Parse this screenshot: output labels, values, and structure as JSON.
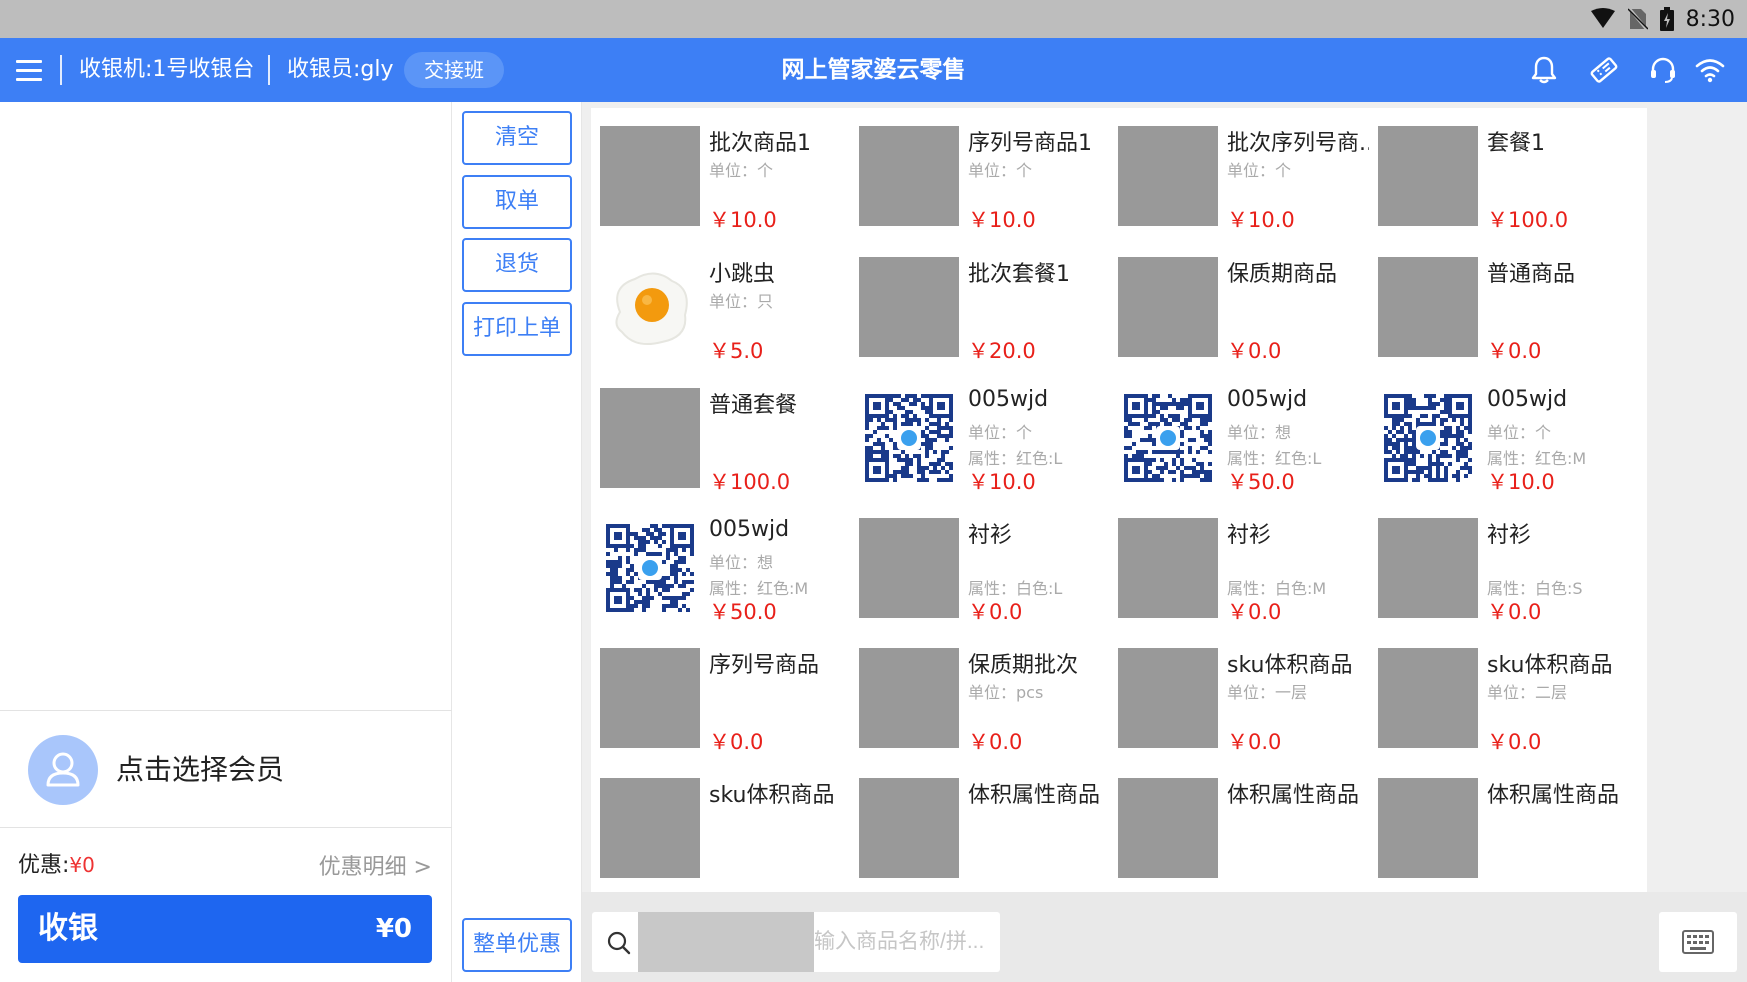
{
  "status_bar": {
    "time": "8:30"
  },
  "header": {
    "register": "收银机:1号收银台",
    "cashier": "收银员:gly",
    "shift_button": "交接班",
    "title": "网上管家婆云零售"
  },
  "actions": {
    "clear": "清空",
    "retrieve": "取单",
    "return": "退货",
    "print_last": "打印上单",
    "order_discount": "整单优惠"
  },
  "member": {
    "prompt": "点击选择会员"
  },
  "discount": {
    "label": "优惠:",
    "value": "¥0",
    "detail": "优惠明细 >"
  },
  "checkout": {
    "label": "收银",
    "amount": "¥0"
  },
  "search": {
    "placeholder": "输入商品名称/拼..."
  },
  "products": [
    {
      "name": "批次商品1",
      "unit": "单位：个",
      "attr": "",
      "price": "￥10.0",
      "image": "gray"
    },
    {
      "name": "序列号商品1",
      "unit": "单位：个",
      "attr": "",
      "price": "￥10.0",
      "image": "gray"
    },
    {
      "name": "批次序列号商...",
      "unit": "单位：个",
      "attr": "",
      "price": "￥10.0",
      "image": "gray"
    },
    {
      "name": "套餐1",
      "unit": "",
      "attr": "",
      "price": "￥100.0",
      "image": "gray"
    },
    {
      "name": "小跳虫",
      "unit": "单位：只",
      "attr": "",
      "price": "￥5.0",
      "image": "egg"
    },
    {
      "name": "批次套餐1",
      "unit": "",
      "attr": "",
      "price": "￥20.0",
      "image": "gray"
    },
    {
      "name": "保质期商品",
      "unit": "",
      "attr": "",
      "price": "￥0.0",
      "image": "gray"
    },
    {
      "name": "普通商品",
      "unit": "",
      "attr": "",
      "price": "￥0.0",
      "image": "gray"
    },
    {
      "name": "普通套餐",
      "unit": "",
      "attr": "",
      "price": "￥100.0",
      "image": "gray"
    },
    {
      "name": "005wjd",
      "unit": "单位：个",
      "attr": "属性：红色:L",
      "price": "￥10.0",
      "image": "qr"
    },
    {
      "name": "005wjd",
      "unit": "单位：想",
      "attr": "属性：红色:L",
      "price": "￥50.0",
      "image": "qr"
    },
    {
      "name": "005wjd",
      "unit": "单位：个",
      "attr": "属性：红色:M",
      "price": "￥10.0",
      "image": "qr"
    },
    {
      "name": "005wjd",
      "unit": "单位：想",
      "attr": "属性：红色:M",
      "price": "￥50.0",
      "image": "qr"
    },
    {
      "name": "衬衫",
      "unit": "",
      "attr": "属性：白色:L",
      "price": "￥0.0",
      "image": "gray"
    },
    {
      "name": "衬衫",
      "unit": "",
      "attr": "属性：白色:M",
      "price": "￥0.0",
      "image": "gray"
    },
    {
      "name": "衬衫",
      "unit": "",
      "attr": "属性：白色:S",
      "price": "￥0.0",
      "image": "gray"
    },
    {
      "name": "序列号商品",
      "unit": "",
      "attr": "",
      "price": "￥0.0",
      "image": "gray"
    },
    {
      "name": "保质期批次",
      "unit": "单位：pcs",
      "attr": "",
      "price": "￥0.0",
      "image": "gray"
    },
    {
      "name": "sku体积商品",
      "unit": "单位：一层",
      "attr": "",
      "price": "￥0.0",
      "image": "gray"
    },
    {
      "name": "sku体积商品",
      "unit": "单位：二层",
      "attr": "",
      "price": "￥0.0",
      "image": "gray"
    },
    {
      "name": "sku体积商品",
      "unit": "",
      "attr": "",
      "price": "",
      "image": "gray"
    },
    {
      "name": "体积属性商品",
      "unit": "",
      "attr": "",
      "price": "",
      "image": "gray"
    },
    {
      "name": "体积属性商品",
      "unit": "",
      "attr": "",
      "price": "",
      "image": "gray"
    },
    {
      "name": "体积属性商品",
      "unit": "",
      "attr": "",
      "price": "",
      "image": "gray"
    }
  ],
  "colors": {
    "primary": "#3d7ff5",
    "checkout": "#1e66f0",
    "price": "#e8201a",
    "status_bar": "#bdbdbd"
  },
  "icons": [
    "menu-icon",
    "bell-icon",
    "tag-icon",
    "headset-icon",
    "wifi-icon",
    "search-icon",
    "keyboard-icon",
    "user-icon"
  ]
}
